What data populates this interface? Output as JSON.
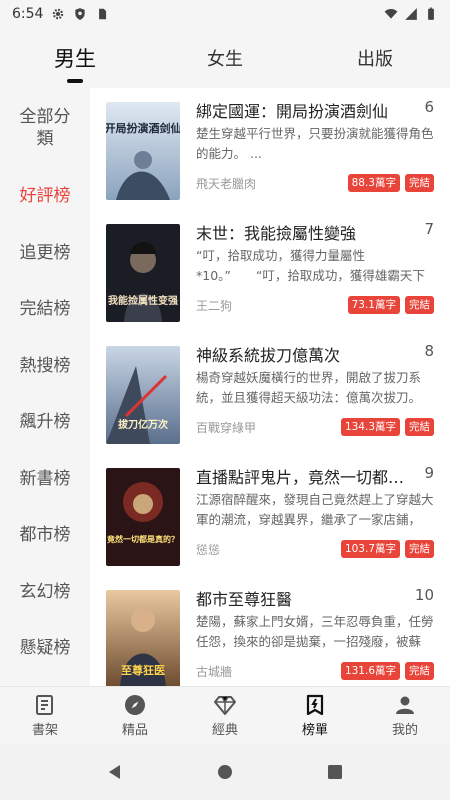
{
  "status_bar": {
    "time": "6:54"
  },
  "top_tabs": [
    {
      "label": "男生",
      "active": true
    },
    {
      "label": "女生",
      "active": false
    },
    {
      "label": "出版",
      "active": false
    }
  ],
  "sidebar": {
    "items": [
      {
        "label": "全部分類",
        "active": false
      },
      {
        "label": "好評榜",
        "active": true
      },
      {
        "label": "追更榜",
        "active": false
      },
      {
        "label": "完結榜",
        "active": false
      },
      {
        "label": "熱搜榜",
        "active": false
      },
      {
        "label": "飆升榜",
        "active": false
      },
      {
        "label": "新書榜",
        "active": false
      },
      {
        "label": "都市榜",
        "active": false
      },
      {
        "label": "玄幻榜",
        "active": false
      },
      {
        "label": "懸疑榜",
        "active": false
      }
    ]
  },
  "books": [
    {
      "title": "綁定國運：開局扮演酒劍仙",
      "rank": "6",
      "desc": "楚生穿越平行世界，只要扮演就能獲得角色的能力。 ...",
      "author": "飛天老臘肉",
      "words": "88.3萬字",
      "status": "完結",
      "cover_text": "开局扮演酒剑仙"
    },
    {
      "title": "末世：我能撿屬性變強",
      "rank": "7",
      "desc": "“叮，拾取成功，獲得力量屬性*10。”　　“叮，拾取成功，獲得雄霸天下LV1。”...",
      "author": "王二狗",
      "words": "73.1萬字",
      "status": "完結",
      "cover_text": "我能捡属性变强"
    },
    {
      "title": "神級系統拔刀億萬次",
      "rank": "8",
      "desc": "楊奇穿越妖魔橫行的世界，開啟了拔刀系統，並且獲得超天級功法：億萬次拔刀。 ...",
      "author": "百戰穿綠甲",
      "words": "134.3萬字",
      "status": "完結",
      "cover_text": "拔刀亿万次"
    },
    {
      "title": "直播點評鬼片，竟然一切都是真的？",
      "rank": "9",
      "desc": "江源宿醉醒來，發現自己竟然趕上了穿越大軍的潮流，穿越異界，繼承了一家店鋪，並...",
      "author": "慫慫",
      "words": "103.7萬字",
      "status": "完結",
      "cover_text": "竟然一切都是真的？"
    },
    {
      "title": "都市至尊狂醫",
      "rank": "10",
      "desc": "楚陽，蘇家上門女婿，三年忍辱負重，任勞任怨，換來的卻是拋棄，一招殘廢，被蘇家...",
      "author": "古城牆",
      "words": "131.6萬字",
      "status": "完結",
      "cover_text": "至尊狂医"
    }
  ],
  "bottom_nav": [
    {
      "label": "書架",
      "icon": "bookshelf-icon",
      "active": false
    },
    {
      "label": "精品",
      "icon": "compass-icon",
      "active": false
    },
    {
      "label": "經典",
      "icon": "diamond-icon",
      "active": false
    },
    {
      "label": "榜單",
      "icon": "ranking-icon",
      "active": true
    },
    {
      "label": "我的",
      "icon": "profile-icon",
      "active": false
    }
  ],
  "colors": {
    "accent": "#e8443a",
    "background": "#f5f5f5"
  }
}
